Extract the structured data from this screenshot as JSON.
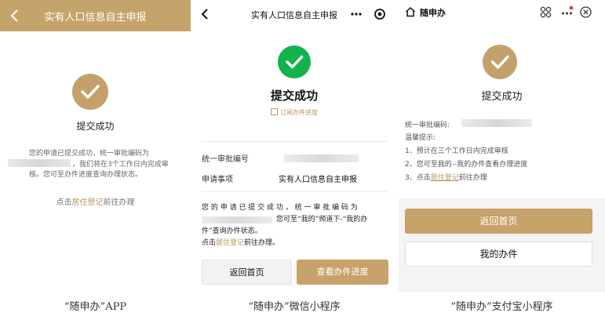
{
  "app_panel": {
    "title": "实有人口信息自主申报",
    "success_text": "提交成功",
    "message_line1": "您的申请已提交成功，统一审批编码为",
    "message_line2": "，我们将在3个工作日内完成审",
    "message_line3": "核。您可至办件进度查询办理状态。",
    "link_prefix": "点击",
    "link_text": "居住登记",
    "link_suffix": "前往办理",
    "caption": "“随申办”APP",
    "accent_color": "#c5a46b"
  },
  "wechat_panel": {
    "title": "实有人口信息自主申报",
    "success_text": "提交成功",
    "subscribe_text": "订阅办件进度",
    "row1_label": "统一审批编号",
    "row2_label": "申请事项",
    "row2_value": "实有人口信息自主申报",
    "para_line1": "您 的 申 请 已 提 交 成 功 ， 统 一 审 批 编 码 为",
    "para_line2": "您可至“我的”频道下-“我的办",
    "para_line3": "件”查询办件状态。",
    "link_prefix": "点击",
    "link_text": "居住登记",
    "link_suffix": "前往办理。",
    "btn_home": "返回首页",
    "btn_progress": "查看办件进度",
    "caption": "“随申办”微信小程序",
    "success_color": "#13b34b"
  },
  "alipay_panel": {
    "app_title": "随申办",
    "success_text": "提交成功",
    "code_label": "统一审批编码:",
    "tips_label": "温馨提示:",
    "tip1": "1、预计在三个工作日内完成审核",
    "tip2": "2、您可至我的--我的办件查看办理进度",
    "tip3_prefix": "3、点击",
    "tip3_link": "居住登记",
    "tip3_suffix": "前往办理",
    "btn_home": "返回首页",
    "btn_mine": "我的办件",
    "caption": "“随申办”支付宝小程序",
    "accent_color": "#c8a26b"
  }
}
